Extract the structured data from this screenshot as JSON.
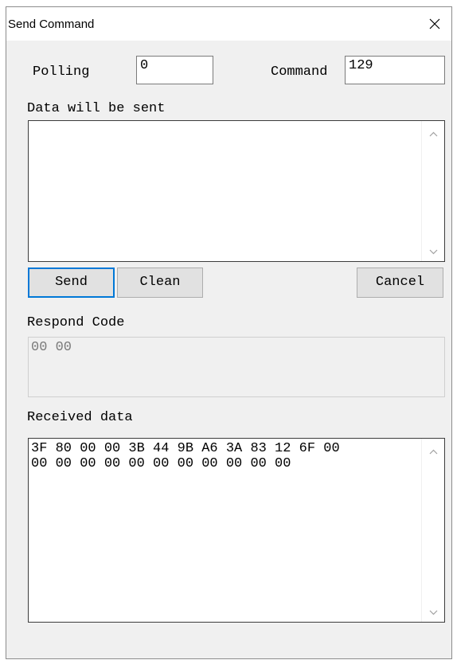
{
  "window": {
    "title": "Send Command",
    "close_icon": "close-icon"
  },
  "polling": {
    "label": "Polling",
    "value": "0"
  },
  "command": {
    "label": "Command",
    "value": "129"
  },
  "send_data": {
    "label": "Data will be sent",
    "value": ""
  },
  "buttons": {
    "send": "Send",
    "clean": "Clean",
    "cancel": "Cancel"
  },
  "respond_code": {
    "label": "Respond Code",
    "value": "00 00"
  },
  "received": {
    "label": "Received data",
    "value": "3F 80 00 00 3B 44 9B A6 3A 83 12 6F 00\n00 00 00 00 00 00 00 00 00 00 00"
  },
  "colors": {
    "focus": "#0078d7",
    "dialog_bg": "#f0f0f0"
  }
}
